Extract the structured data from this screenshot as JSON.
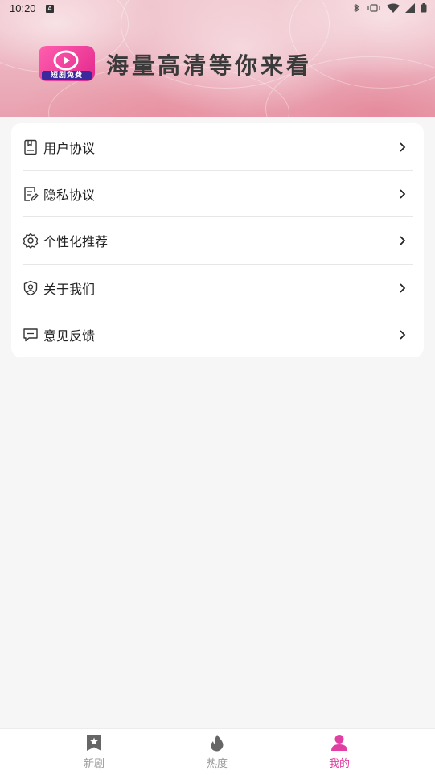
{
  "status_bar": {
    "time": "10:20",
    "notification_glyph": "A"
  },
  "header": {
    "logo_tag": "短剧免费",
    "slogan": "海量高清等你来看"
  },
  "menu": {
    "items": [
      {
        "label": "用户协议",
        "icon": "document-icon"
      },
      {
        "label": "隐私协议",
        "icon": "edit-document-icon"
      },
      {
        "label": "个性化推荐",
        "icon": "gear-icon"
      },
      {
        "label": "关于我们",
        "icon": "shield-user-icon"
      },
      {
        "label": "意见反馈",
        "icon": "message-icon"
      }
    ]
  },
  "tabbar": {
    "tabs": [
      {
        "label": "新剧",
        "icon": "star-bookmark-icon",
        "active": false
      },
      {
        "label": "热度",
        "icon": "flame-icon",
        "active": false
      },
      {
        "label": "我的",
        "icon": "person-icon",
        "active": true
      }
    ],
    "active_color": "#e23fa5",
    "inactive_color": "#999999"
  }
}
